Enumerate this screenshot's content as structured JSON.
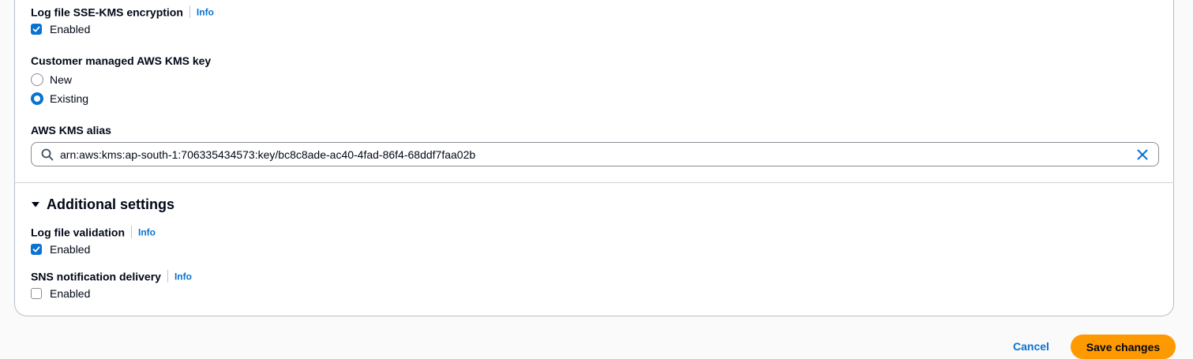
{
  "log_file_encryption": {
    "label": "Log file SSE-KMS encryption",
    "info": "Info",
    "checkbox_label": "Enabled",
    "checked": true
  },
  "kms_key": {
    "label": "Customer managed AWS KMS key",
    "options": [
      {
        "label": "New",
        "selected": false
      },
      {
        "label": "Existing",
        "selected": true
      }
    ]
  },
  "kms_alias": {
    "label": "AWS KMS alias",
    "value": "arn:aws:kms:ap-south-1:706335434573:key/bc8c8ade-ac40-4fad-86f4-68ddf7faa02b",
    "icons": {
      "search": "search-icon",
      "clear": "close-icon"
    }
  },
  "additional_settings": {
    "title": "Additional settings",
    "expanded": true,
    "log_file_validation": {
      "label": "Log file validation",
      "info": "Info",
      "checkbox_label": "Enabled",
      "checked": true
    },
    "sns_delivery": {
      "label": "SNS notification delivery",
      "info": "Info",
      "checkbox_label": "Enabled",
      "checked": false
    }
  },
  "actions": {
    "cancel_label": "Cancel",
    "save_label": "Save changes"
  },
  "colors": {
    "accent": "#0972d3",
    "primary_button": "#ff9900",
    "border": "#8c8c94"
  }
}
